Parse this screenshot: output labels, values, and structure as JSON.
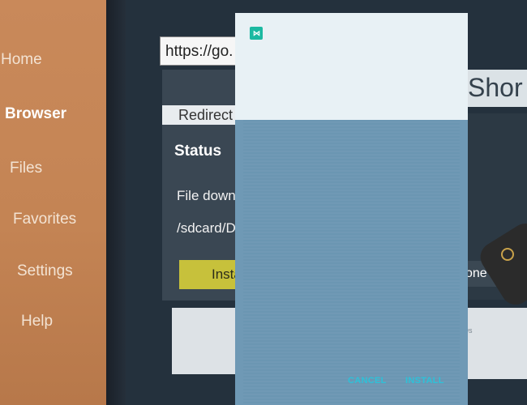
{
  "sidebar": {
    "items": [
      {
        "label": "Home"
      },
      {
        "label": "Browser"
      },
      {
        "label": "Files"
      },
      {
        "label": "Favorites"
      },
      {
        "label": "Settings"
      },
      {
        "label": "Help"
      }
    ]
  },
  "browser": {
    "url": "https://go.",
    "redirect_label": "Redirect",
    "shorts_label": "Shor",
    "status_title": "Status",
    "file_status": "File down",
    "path": "/sdcard/D",
    "install_button": "Insta",
    "done_button": "one",
    "faq_text": "Qs"
  },
  "dialog": {
    "app_icon": "app-install-icon",
    "cancel_label": "CANCEL",
    "install_label": "INSTALL"
  },
  "colors": {
    "sidebar": "#c48454",
    "accent_button": "#c7c13b",
    "dialog_action": "#2ec1d8"
  }
}
